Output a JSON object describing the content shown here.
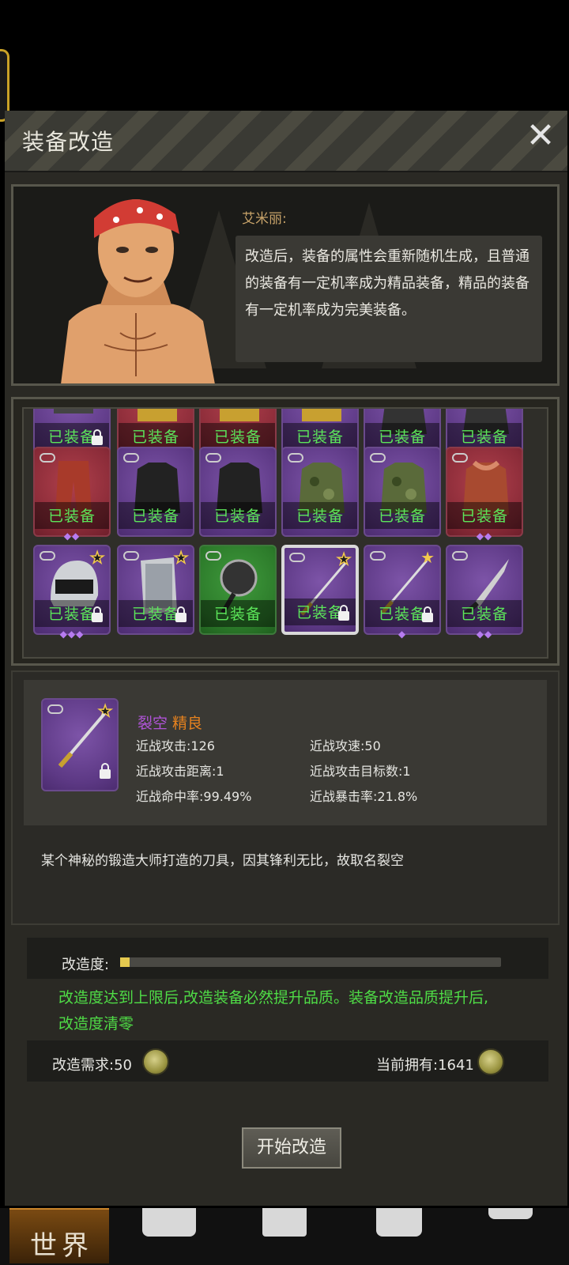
{
  "dialog": {
    "title": "装备改造"
  },
  "npc": {
    "name": "艾米丽:",
    "speech": "改造后，装备的属性会重新随机生成，且普通的装备有一定机率成为精品装备，精品的装备有一定机率成为完美装备。"
  },
  "equipped_label": "已装备",
  "colors": {
    "purple": "#5d3985",
    "red": "#8a2b38",
    "green": "#2c7a2a",
    "equipped_text": "#5ce65a",
    "quality_text": "#e6821e",
    "name_text": "#b054d8",
    "notice_text": "#4fdc46"
  },
  "grid": {
    "rows": [
      [
        {
          "item": "pistol",
          "rarity": "purple",
          "locked": true,
          "equipped": true
        },
        {
          "item": "ammo-belt",
          "rarity": "red",
          "equipped": true
        },
        {
          "item": "ammo-belt",
          "rarity": "red",
          "equipped": true
        },
        {
          "item": "ammo-belt",
          "rarity": "purple",
          "equipped": true
        },
        {
          "item": "jacket",
          "rarity": "purple",
          "equipped": true,
          "gems": 1
        },
        {
          "item": "jacket",
          "rarity": "purple",
          "equipped": true
        }
      ],
      [
        {
          "item": "pants",
          "rarity": "red",
          "equipped": true,
          "gems": 2
        },
        {
          "item": "black-shirt",
          "rarity": "purple",
          "equipped": true
        },
        {
          "item": "black-shirt",
          "rarity": "purple",
          "equipped": true
        },
        {
          "item": "camo-jacket",
          "rarity": "purple",
          "equipped": true
        },
        {
          "item": "camo-jacket",
          "rarity": "purple",
          "equipped": true
        },
        {
          "item": "fur-coat",
          "rarity": "red",
          "equipped": true,
          "gems": 2
        }
      ],
      [
        {
          "item": "police-helmet",
          "rarity": "purple",
          "star": "outline",
          "locked": true,
          "equipped": true,
          "gems": 3
        },
        {
          "item": "riot-shield",
          "rarity": "purple",
          "star": "outline",
          "locked": true,
          "equipped": true
        },
        {
          "item": "frying-pan",
          "rarity": "green",
          "equipped": true
        },
        {
          "item": "katana",
          "rarity": "purple",
          "star": "outline",
          "locked": true,
          "equipped": true,
          "selected": true
        },
        {
          "item": "katana",
          "rarity": "purple",
          "star": "filled",
          "locked": true,
          "equipped": true,
          "gems": 1
        },
        {
          "item": "machete",
          "rarity": "purple",
          "equipped": true,
          "gems": 2
        }
      ]
    ]
  },
  "detail": {
    "name": "裂空",
    "quality": "精良",
    "stats": [
      {
        "label": "近战攻击:126"
      },
      {
        "label": "近战攻速:50"
      },
      {
        "label": "近战攻击距离:1"
      },
      {
        "label": "近战攻击目标数:1"
      },
      {
        "label": "近战命中率:99.49%"
      },
      {
        "label": "近战暴击率:21.8%"
      }
    ],
    "description": "某个神秘的锻造大师打造的刀具，因其锋利无比，故取名裂空"
  },
  "progress": {
    "label": "改造度:",
    "value_fraction": 0.025,
    "notice": "改造度达到上限后,改造装备必然提升品质。装备改造品质提升后,改造度清零"
  },
  "cost": {
    "required_label": "改造需求:50",
    "owned_label": "当前拥有:1641"
  },
  "start_button": "开始改造",
  "nav": {
    "world": "世界",
    "items": [
      "backpack-icon",
      "anvil-icon",
      "building-icon",
      "workbench-icon"
    ]
  }
}
